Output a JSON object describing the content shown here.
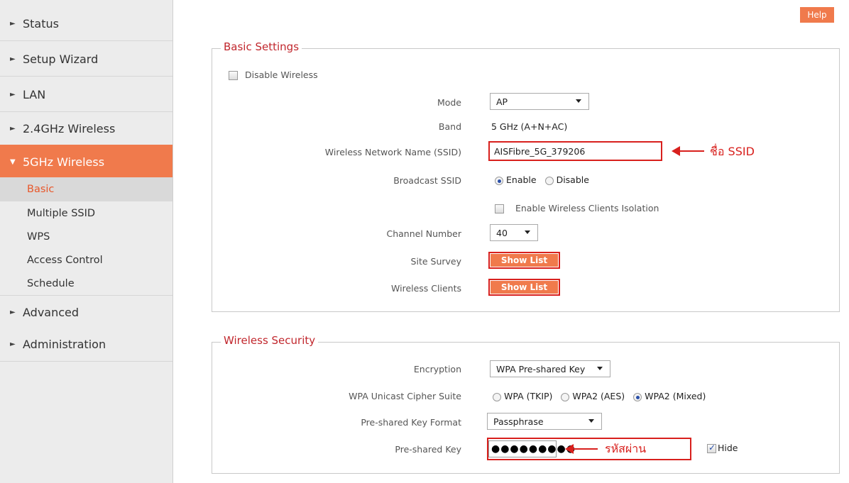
{
  "sidebar": {
    "items": [
      {
        "label": "Status"
      },
      {
        "label": "Setup Wizard"
      },
      {
        "label": "LAN"
      },
      {
        "label": "2.4GHz Wireless"
      },
      {
        "label": "5GHz Wireless"
      },
      {
        "label": "Advanced"
      },
      {
        "label": "Administration"
      }
    ],
    "sub_items": [
      {
        "label": "Basic"
      },
      {
        "label": "Multiple SSID"
      },
      {
        "label": "WPS"
      },
      {
        "label": "Access Control"
      },
      {
        "label": "Schedule"
      }
    ]
  },
  "help_label": "Help",
  "basic": {
    "legend": "Basic Settings",
    "disable_wireless_label": "Disable  Wireless",
    "mode_label": "Mode",
    "mode_value": "AP",
    "band_label": "Band",
    "band_value": "5 GHz (A+N+AC)",
    "ssid_label": "Wireless Network Name  (SSID)",
    "ssid_value": "AISFibre_5G_379206",
    "ssid_annotation": "ชื่อ SSID",
    "broadcast_label": "Broadcast SSID",
    "broadcast_enable": "Enable",
    "broadcast_disable": "Disable",
    "isolation_label": "Enable Wireless Clients Isolation",
    "channel_label": "Channel Number",
    "channel_value": "40",
    "site_survey_label": "Site Survey",
    "site_survey_button": "Show List",
    "clients_label": "Wireless Clients",
    "clients_button": "Show List"
  },
  "security": {
    "legend": "Wireless  Security",
    "encryption_label": "Encryption",
    "encryption_value": "WPA Pre-shared Key",
    "cipher_label": "WPA Unicast Cipher Suite",
    "cipher_tkip": "WPA (TKIP)",
    "cipher_aes": "WPA2 (AES)",
    "cipher_mixed": "WPA2 (Mixed)",
    "key_format_label": "Pre-shared Key Format",
    "key_format_value": "Passphrase",
    "key_label": "Pre-shared Key",
    "key_value": "●●●●●●●●●",
    "key_annotation": "รหัสผ่าน",
    "hide_label": "Hide"
  },
  "colors": {
    "accent": "#f07a4c",
    "annotation": "#d8201d",
    "legend": "#c1272d",
    "sidebar_bg": "#ececec"
  }
}
